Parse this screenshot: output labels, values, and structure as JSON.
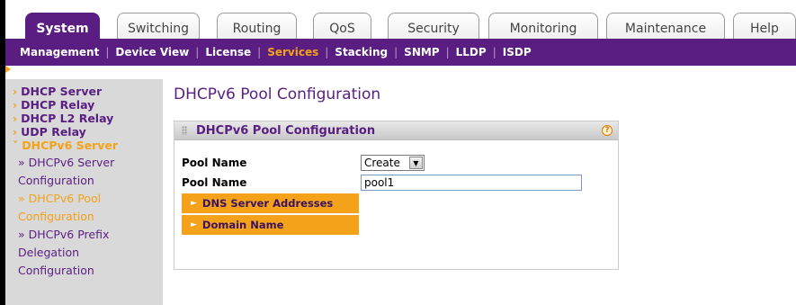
{
  "tabs": [
    {
      "label": "System",
      "active": true
    },
    {
      "label": "Switching",
      "active": false
    },
    {
      "label": "Routing",
      "active": false
    },
    {
      "label": "QoS",
      "active": false
    },
    {
      "label": "Security",
      "active": false
    },
    {
      "label": "Monitoring",
      "active": false
    },
    {
      "label": "Maintenance",
      "active": false
    },
    {
      "label": "Help",
      "active": false
    }
  ],
  "submenu": [
    {
      "label": "Management",
      "active": false
    },
    {
      "label": "Device View",
      "active": false
    },
    {
      "label": "License",
      "active": false
    },
    {
      "label": "Services",
      "active": true
    },
    {
      "label": "Stacking",
      "active": false
    },
    {
      "label": "SNMP",
      "active": false
    },
    {
      "label": "LLDP",
      "active": false
    },
    {
      "label": "ISDP",
      "active": false
    }
  ],
  "sidebar": {
    "items": [
      {
        "label": "DHCP Server"
      },
      {
        "label": "DHCP Relay"
      },
      {
        "label": "DHCP L2 Relay"
      },
      {
        "label": "UDP Relay"
      },
      {
        "label": "DHCPv6 Server"
      }
    ],
    "subitems": [
      {
        "line1": "» DHCPv6 Server",
        "line2": "Configuration"
      },
      {
        "line1": "» DHCPv6 Pool",
        "line2": "Configuration"
      },
      {
        "line1": "» DHCPv6 Prefix",
        "line2": "Delegation",
        "line3": "Configuration"
      }
    ]
  },
  "main": {
    "page_title": "DHCPv6 Pool Configuration",
    "panel_title": "DHCPv6 Pool Configuration",
    "help_symbol": "?",
    "fields": {
      "pool_name_select_label": "Pool Name",
      "pool_name_select_value": "Create",
      "pool_name_input_label": "Pool Name",
      "pool_name_input_value": "pool1"
    },
    "sections": {
      "dns_label": "DNS Server Addresses",
      "domain_label": "Domain Name"
    }
  },
  "colors": {
    "brand_purple": "#5a1e82",
    "accent_orange": "#f4a21a",
    "sidebar_bg": "#d9d9d9"
  }
}
